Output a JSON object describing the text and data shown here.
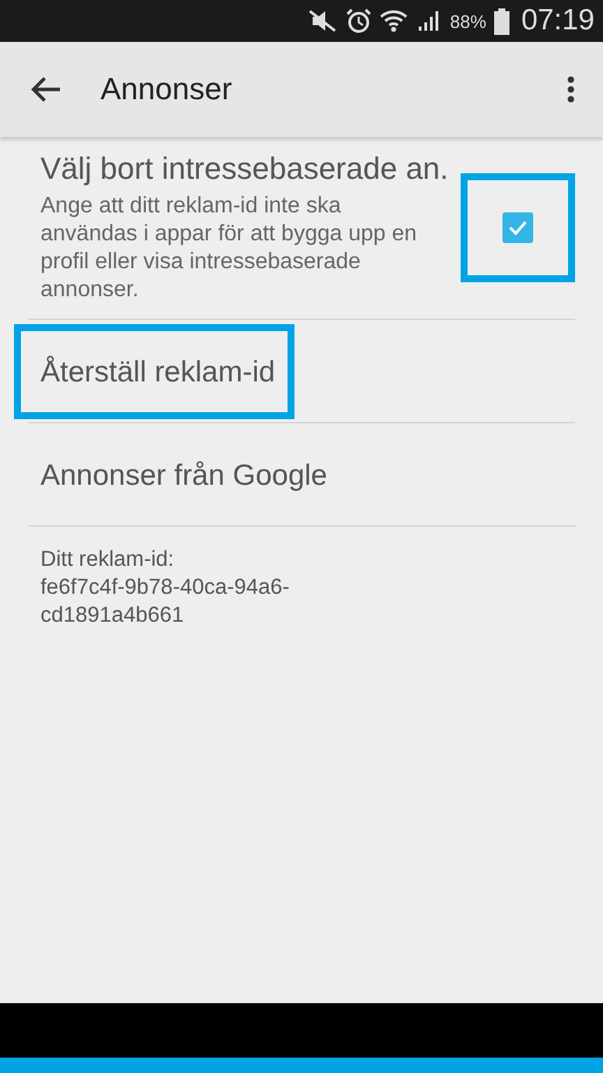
{
  "status_bar": {
    "battery_text": "88%",
    "time": "07:19"
  },
  "app_bar": {
    "title": "Annonser"
  },
  "settings": [
    {
      "kind": "checkbox",
      "title": "Välj bort intressebaserade an.",
      "summary": "Ange att ditt reklam-id inte ska användas i appar för att bygga upp en profil eller visa intressebaserade annonser.",
      "checked": true,
      "highlighted": true
    },
    {
      "kind": "action",
      "title": "Återställ reklam-id",
      "highlighted": true
    },
    {
      "kind": "action",
      "title": "Annonser från Google",
      "highlighted": false
    }
  ],
  "footer": {
    "label": "Ditt reklam-id:",
    "id_lines": [
      "fe6f7c4f-9b78-40ca-94a6-",
      "cd1891a4b661"
    ]
  }
}
